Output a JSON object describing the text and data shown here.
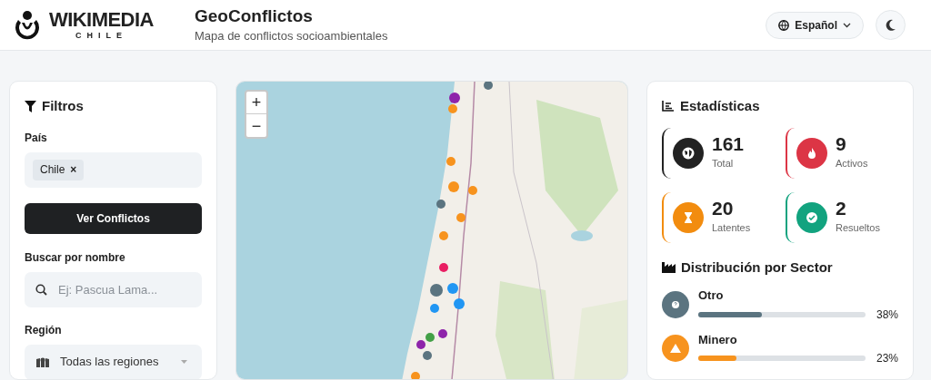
{
  "header": {
    "logo": {
      "name": "WIKIMEDIA",
      "sub": "CHILE"
    },
    "title": "GeoConflictos",
    "subtitle": "Mapa de conflictos socioambientales",
    "language": "Español"
  },
  "filters": {
    "title": "Filtros",
    "country_label": "País",
    "country_tags": [
      "Chile"
    ],
    "tag_remove": "×",
    "submit": "Ver Conflictos",
    "search_label": "Buscar por nombre",
    "search_placeholder": "Ej: Pascua Lama...",
    "region_label": "Región",
    "region_value": "Todas las regiones"
  },
  "map": {
    "kind": "picture",
    "zoom_in": "+",
    "zoom_out": "−"
  },
  "stats": {
    "title": "Estadísticas",
    "items": [
      {
        "kind": "total",
        "value": "161",
        "label": "Total",
        "color": "#222222"
      },
      {
        "kind": "active",
        "value": "9",
        "label": "Activos",
        "color": "#dc3545"
      },
      {
        "kind": "latent",
        "value": "20",
        "label": "Latentes",
        "color": "#f28c0f"
      },
      {
        "kind": "resolved",
        "value": "2",
        "label": "Resueltos",
        "color": "#12a37f"
      }
    ],
    "sector_title": "Distribución por Sector",
    "sectors": [
      {
        "kind": "other",
        "label": "Otro",
        "level": 0.38,
        "reading": "38%",
        "color": "#5b7480"
      },
      {
        "kind": "mining",
        "label": "Minero",
        "level": 0.23,
        "reading": "23%",
        "color": "#f7931e"
      }
    ]
  }
}
